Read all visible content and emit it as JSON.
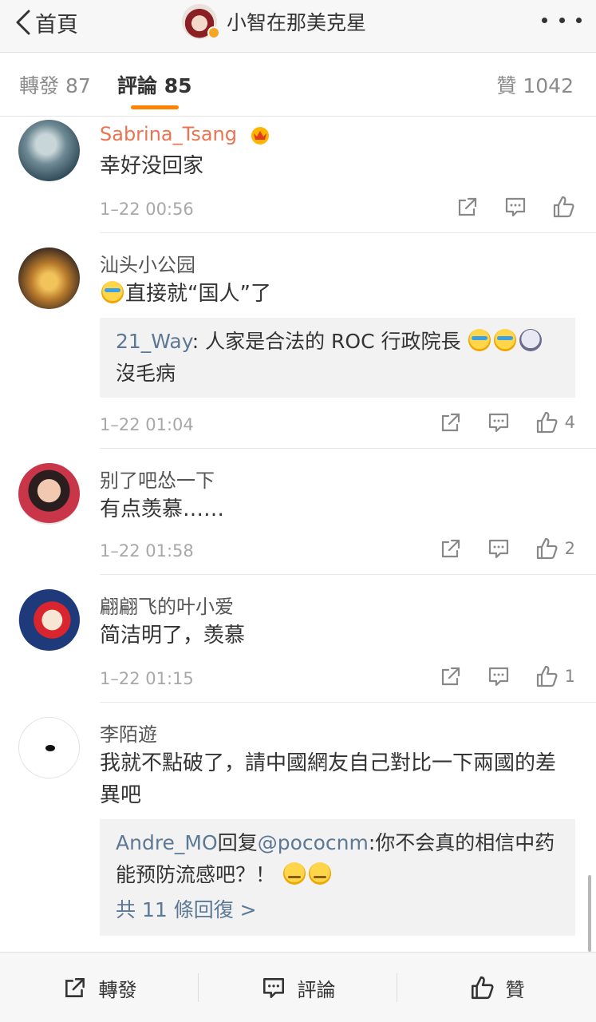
{
  "nav": {
    "back_label": "首頁",
    "title": "小智在那美克星",
    "more_icon": "more-dots-icon"
  },
  "tabs": [
    {
      "label": "轉發 87",
      "active": false
    },
    {
      "label": "評論 85",
      "active": true
    },
    {
      "label": "贊 1042",
      "active": false
    }
  ],
  "comments": [
    {
      "user": "Sabrina_Tsang",
      "vip": true,
      "text": "幸好没回家",
      "time": "1–22 00:56",
      "likes": ""
    },
    {
      "user": "汕头小公园",
      "text": "直接就“国人”了",
      "quote_user": "21_Way",
      "quote_text": ": 人家是合法的 ROC 行政院長",
      "quote_tail": "沒毛病",
      "time": "1–22 01:04",
      "likes": "4"
    },
    {
      "user": "别了吧怂一下",
      "text": "有点羡慕……",
      "time": "1–22 01:58",
      "likes": "2"
    },
    {
      "user": "翩翩飞的叶小爱",
      "text": "简洁明了，羡慕",
      "time": "1–22 01:15",
      "likes": "1"
    },
    {
      "user": "李陌遊",
      "text": "我就不點破了，請中國網友自己對比一下兩國的差異吧",
      "quote_user": "Andre_MO",
      "quote_reply": "回复",
      "quote_mention": "@pococnm",
      "quote_text": ":你不会真的相信中药能预防流感吧？！",
      "quote_more": "共 11 條回復 >"
    }
  ],
  "toolbar": {
    "repost_label": "轉發",
    "comment_label": "評論",
    "like_label": "贊"
  },
  "colors": {
    "accent": "#ff8200",
    "vip_name": "#eb7350",
    "link": "#5d7895",
    "meta": "#a8a8a8"
  }
}
